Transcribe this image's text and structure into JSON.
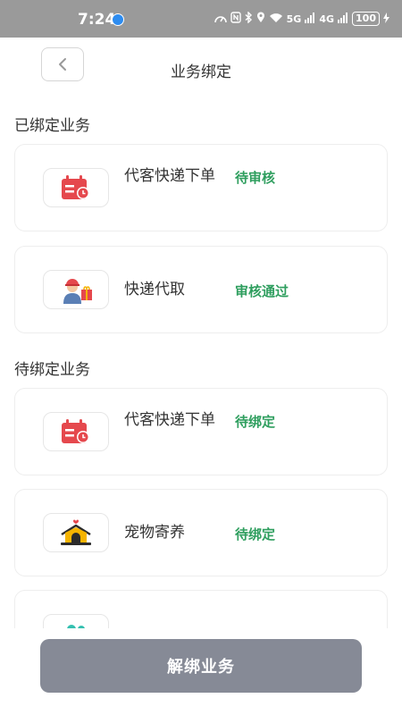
{
  "status_bar": {
    "time": "7:24",
    "network_4g": "4G",
    "network_5g": "5G",
    "battery": "100"
  },
  "header": {
    "title": "业务绑定"
  },
  "bound_section": {
    "title": "已绑定业务",
    "items": [
      {
        "name": "代客快递下单",
        "status": "待审核",
        "icon": "calendar-clock-icon"
      },
      {
        "name": "快递代取",
        "status": "审核通过",
        "icon": "courier-icon"
      }
    ]
  },
  "pending_section": {
    "title": "待绑定业务",
    "items": [
      {
        "name": "代客快递下单",
        "status": "待绑定",
        "icon": "calendar-clock-icon"
      },
      {
        "name": "宠物寄养",
        "status": "待绑定",
        "icon": "pet-house-icon"
      }
    ]
  },
  "footer": {
    "unbind_label": "解绑业务"
  },
  "colors": {
    "status_green": "#2e9e5e",
    "button_gray": "#868a96",
    "icon_red": "#e5484d"
  }
}
